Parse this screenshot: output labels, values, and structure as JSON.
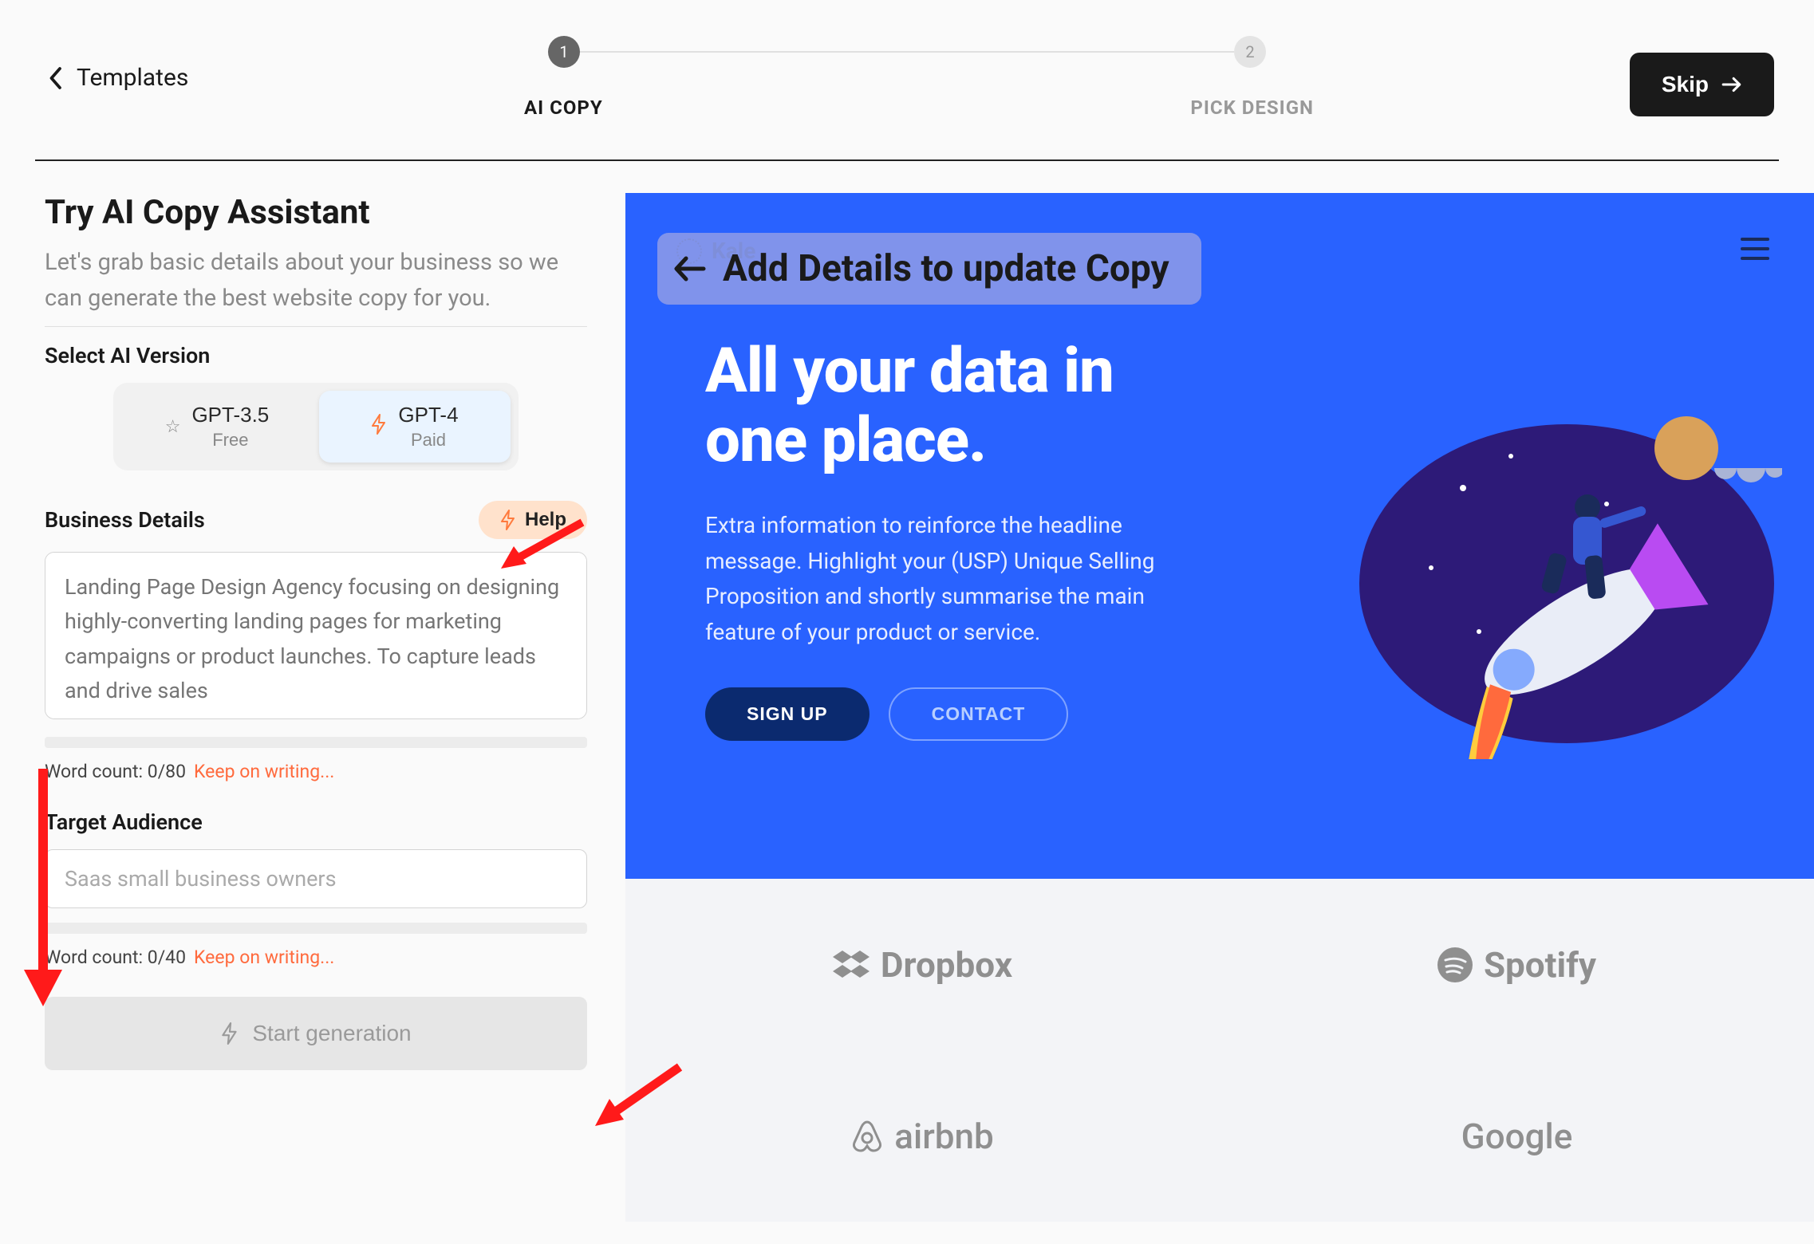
{
  "topbar": {
    "templates": "Templates",
    "skip": "Skip"
  },
  "stepper": {
    "step1_num": "1",
    "step2_num": "2",
    "step1_label": "AI COPY",
    "step2_label": "PICK DESIGN"
  },
  "form": {
    "title": "Try AI Copy Assistant",
    "subtitle": "Let's grab basic details about your business so we can generate the best website copy for you.",
    "select_version_label": "Select AI Version",
    "versions": [
      {
        "name": "GPT-3.5",
        "tier": "Free"
      },
      {
        "name": "GPT-4",
        "tier": "Paid"
      }
    ],
    "business_label": "Business Details",
    "help_label": "Help",
    "business_placeholder": "Landing Page Design Agency focusing on designing highly-converting landing pages for marketing campaigns or product launches. To capture leads and drive sales",
    "wc1": "Word count: 0/80",
    "wc_hint1": "Keep on writing...",
    "audience_label": "Target Audience",
    "audience_placeholder": "Saas small business owners",
    "wc2": "Word count: 0/40",
    "wc_hint2": "Keep on writing...",
    "generate": "Start generation"
  },
  "preview": {
    "overlay": "Add Details to update Copy",
    "brand_name": "Kale",
    "hero_title": "All your data in one place.",
    "hero_sub": "Extra information to reinforce the headline message. Highlight your (USP) Unique Selling Proposition and shortly summarise the main feature of your product or service.",
    "signup": "SIGN UP",
    "contact": "CONTACT",
    "brands": [
      "Dropbox",
      "Spotify",
      "airbnb",
      "Google"
    ]
  }
}
